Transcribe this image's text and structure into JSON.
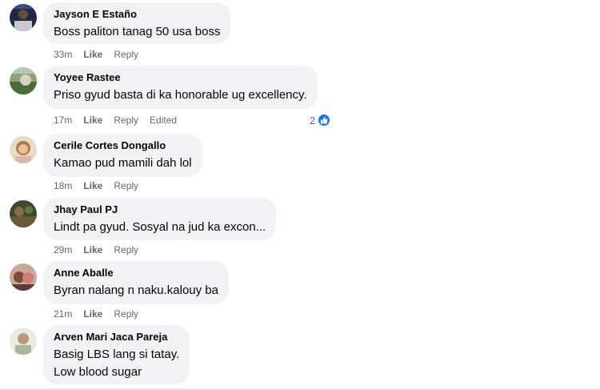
{
  "comments": [
    {
      "name": "Jayson E Estaño",
      "lines": [
        "Boss paliton tanag 50 usa boss"
      ],
      "time": "33m",
      "like": "Like",
      "reply": "Reply",
      "edited": "",
      "reactions": ""
    },
    {
      "name": "Yoyee Rastee",
      "lines": [
        "Priso gyud basta di ka honorable ug excellency."
      ],
      "time": "17m",
      "like": "Like",
      "reply": "Reply",
      "edited": "Edited",
      "reactions": "2"
    },
    {
      "name": "Cerile Cortes Dongallo",
      "lines": [
        "Kamao pud mamili dah lol"
      ],
      "time": "18m",
      "like": "Like",
      "reply": "Reply",
      "edited": "",
      "reactions": ""
    },
    {
      "name": "Jhay Paul PJ",
      "lines": [
        "Lindt pa gyud. Sosyal na jud ka excon..."
      ],
      "time": "29m",
      "like": "Like",
      "reply": "Reply",
      "edited": "",
      "reactions": ""
    },
    {
      "name": "Anne Aballe",
      "lines": [
        "Byran nalang n naku.kalouy ba"
      ],
      "time": "21m",
      "like": "Like",
      "reply": "Reply",
      "edited": "",
      "reactions": ""
    },
    {
      "name": "Arven Mari Jaca Pareja",
      "lines": [
        "Basig LBS lang si tatay.",
        "Low blood sugar"
      ],
      "time": "",
      "like": "",
      "reply": "",
      "edited": "",
      "reactions": ""
    }
  ],
  "icons": {
    "reaction": "thumbs-up-icon"
  },
  "colors": {
    "bubble": "#f0f2f5",
    "meta": "#65676b",
    "like_badge": "#1877f2"
  }
}
